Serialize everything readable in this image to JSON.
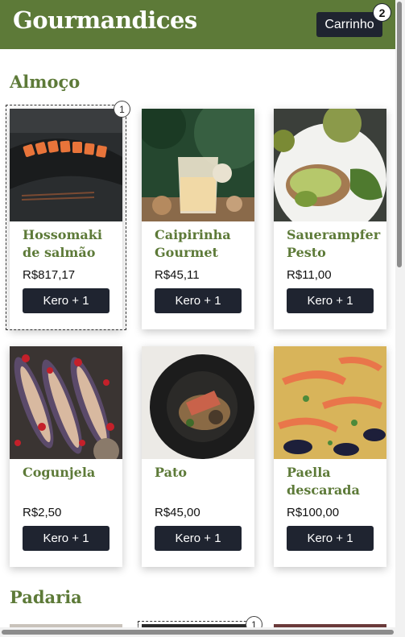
{
  "header": {
    "brand": "Gourmandices",
    "cart_label": "Carrinho",
    "cart_count": "2",
    "bg_color": "#5d7a38"
  },
  "sections": [
    {
      "title": "Almoço",
      "products": [
        {
          "name": "Hossomaki de salmão",
          "price": "R$817,17",
          "button": "Kero + 1",
          "qty_badge": "1",
          "image": "salmon-sushi-roll"
        },
        {
          "name": "Caipirinha Gourmet",
          "price": "R$45,11",
          "button": "Kero + 1",
          "image": "cocktail-glass"
        },
        {
          "name": "Sauerampfer Pesto",
          "price": "R$11,00",
          "button": "Kero + 1",
          "image": "avocado-toast-pesto"
        },
        {
          "name": "Cogunjela",
          "price": "R$2,50",
          "button": "Kero + 1",
          "image": "roasted-eggplant-pomegranate"
        },
        {
          "name": "Pato",
          "price": "R$45,00",
          "button": "Kero + 1",
          "image": "duck-dish-black-plate"
        },
        {
          "name": "Paella descarada",
          "price": "R$100,00",
          "button": "Kero + 1",
          "image": "seafood-paella"
        }
      ]
    },
    {
      "title": "Padaria",
      "qty_badge": "1"
    }
  ],
  "colors": {
    "accent": "#5d7a38",
    "button": "#1f2430"
  }
}
